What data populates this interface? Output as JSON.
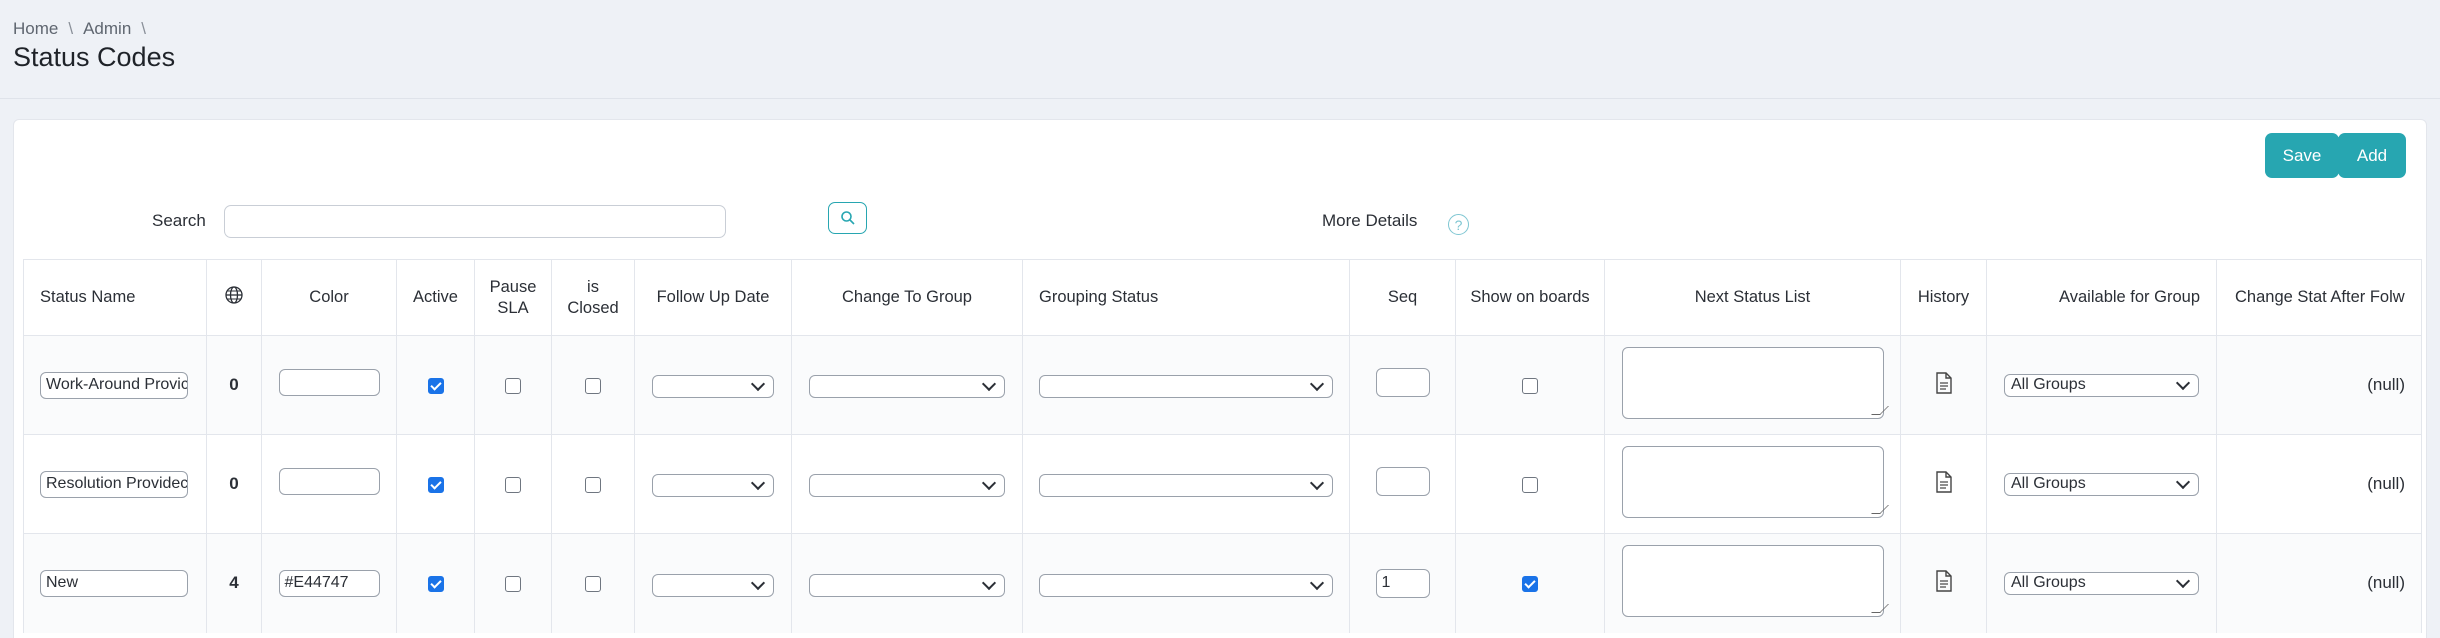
{
  "breadcrumb": {
    "home": "Home",
    "admin": "Admin",
    "sep": "\\"
  },
  "page": {
    "title": "Status Codes"
  },
  "toolbar": {
    "save_label": "Save",
    "add_label": "Add"
  },
  "search": {
    "label": "Search",
    "value": "",
    "more_details_label": "More Details",
    "help_glyph": "?"
  },
  "icons": {
    "search": "search-icon",
    "globe": "globe-icon",
    "history": "document-icon",
    "help": "help-circle-icon"
  },
  "colors": {
    "accent": "#27a6b1",
    "checkbox_checked": "#1a73e8"
  },
  "table": {
    "headers": {
      "status_name": "Status Name",
      "color": "Color",
      "active": "Active",
      "pause_sla_1": "Pause",
      "pause_sla_2": "SLA",
      "is_closed_1": "is",
      "is_closed_2": "Closed",
      "follow_up": "Follow Up Date",
      "change_to_group": "Change To Group",
      "grouping_status": "Grouping Status",
      "seq": "Seq",
      "show_on_boards": "Show on boards",
      "next_status_list": "Next Status List",
      "history": "History",
      "available_for_group": "Available for Group",
      "change_stat_after": "Change Stat After Folw"
    },
    "rows": [
      {
        "name": "Work-Around Provic",
        "count": "0",
        "color": "",
        "active": true,
        "pause_sla": false,
        "is_closed": false,
        "seq": "",
        "show_on_boards": false,
        "available_for_group": "All Groups",
        "change_stat_after": "(null)"
      },
      {
        "name": "Resolution Providec",
        "count": "0",
        "color": "",
        "active": true,
        "pause_sla": false,
        "is_closed": false,
        "seq": "",
        "show_on_boards": false,
        "available_for_group": "All Groups",
        "change_stat_after": "(null)"
      },
      {
        "name": "New",
        "count": "4",
        "color": "#E44747",
        "active": true,
        "pause_sla": false,
        "is_closed": false,
        "seq": "1",
        "show_on_boards": true,
        "available_for_group": "All Groups",
        "change_stat_after": "(null)"
      }
    ]
  }
}
